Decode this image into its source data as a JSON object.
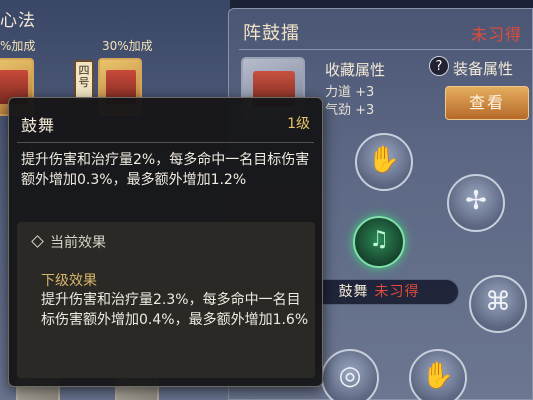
{
  "left": {
    "title": "心法",
    "bonus_left": "%加成",
    "bonus_right": "30%加成",
    "card_badge": "四号"
  },
  "panel": {
    "title": "阵鼓擂",
    "status": "未习得",
    "collect_attr_label": "收藏属性",
    "attrs": [
      "力道 +3",
      "气劲 +3"
    ],
    "help_icon": "?",
    "equip_attr_label": "装备属性",
    "view_button": "查看"
  },
  "wheel": {
    "skill_name": "鼓舞",
    "skill_status": "未习得",
    "nodes": [
      "palm-icon",
      "cross-seal-icon",
      "scroll-icon",
      "eye-seal-icon",
      "hand-icon"
    ]
  },
  "tooltip": {
    "name": "鼓舞",
    "level": "1级",
    "description": "提升伤害和治疗量2%，每多命中一名目标伤害额外增加0.3%，最多额外增加1.2%",
    "current_effect_label": "当前效果",
    "next_effect_label": "下级效果",
    "next_effect_desc": "提升伤害和治疗量2.3%，每多命中一名目标伤害额外增加0.4%，最多额外增加1.6%"
  },
  "colors": {
    "status_red": "#e24b3b",
    "level_gold": "#e6c46a",
    "button_orange": "#d08a3e"
  }
}
